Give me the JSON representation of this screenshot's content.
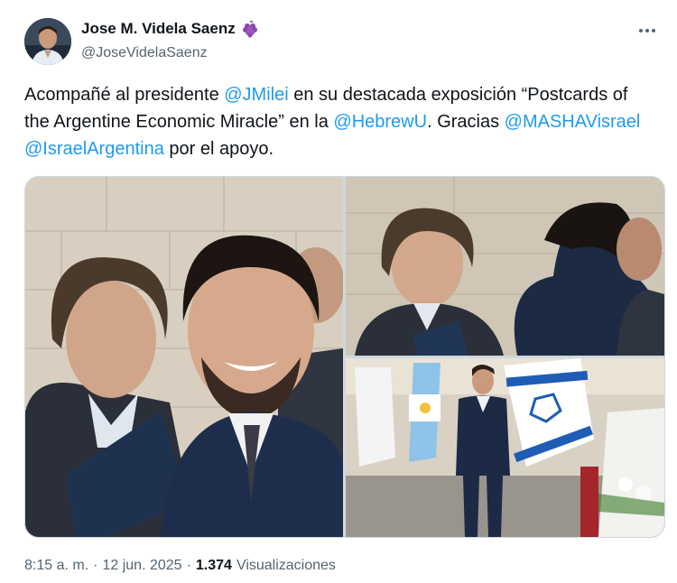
{
  "author": {
    "display_name": "Jose M. Videla Saenz",
    "badge_icon": "grapes-icon",
    "handle": "@JoseVidelaSaenz"
  },
  "tweet": {
    "segments": [
      {
        "text": "Acompañé al presidente ",
        "type": "plain"
      },
      {
        "text": "@JMilei",
        "type": "mention"
      },
      {
        "text": " en su destacada exposición “Postcards of the Argentine Economic Miracle” en la ",
        "type": "plain"
      },
      {
        "text": "@HebrewU",
        "type": "mention"
      },
      {
        "text": ". Gracias ",
        "type": "plain"
      },
      {
        "text": "@MASHAVisrael",
        "type": "mention"
      },
      {
        "text": " ",
        "type": "plain"
      },
      {
        "text": "@IsraelArgentina",
        "type": "mention"
      },
      {
        "text": " por el apoyo.",
        "type": "plain"
      }
    ]
  },
  "meta": {
    "time": "8:15 a. m.",
    "separator": "·",
    "date": "12 jun. 2025",
    "views_count": "1.374",
    "views_label": "Visualizaciones"
  },
  "colors": {
    "text": "#0f1419",
    "secondary": "#536471",
    "link": "#1d9bf0",
    "border": "#cfd9de"
  }
}
